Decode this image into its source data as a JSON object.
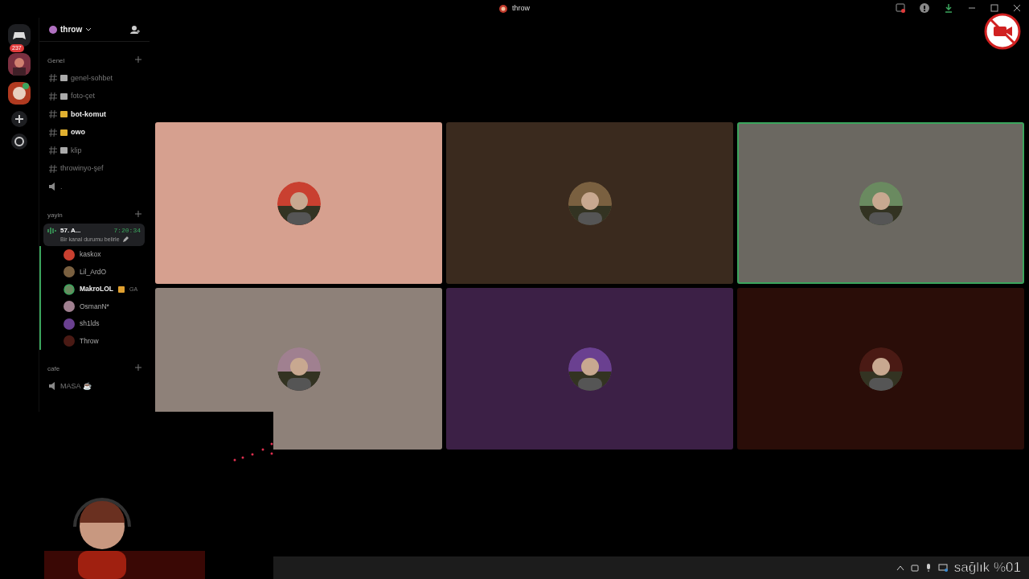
{
  "window": {
    "title": "throw"
  },
  "server_rail": {
    "badge": "237"
  },
  "server_header": {
    "name": "throw"
  },
  "categories": [
    {
      "name": "Genel",
      "channels": [
        {
          "name": "genel-sohbet",
          "kind": "text",
          "emoji": true,
          "unread": false
        },
        {
          "name": "foto-çet",
          "kind": "text",
          "emoji": true,
          "unread": false
        },
        {
          "name": "bot-komut",
          "kind": "text",
          "emoji": true,
          "unread": true
        },
        {
          "name": "owo",
          "kind": "text",
          "emoji": true,
          "unread": true
        },
        {
          "name": "klip",
          "kind": "text",
          "emoji": true,
          "unread": false
        },
        {
          "name": "throwinyo-şef",
          "kind": "text",
          "emoji": false,
          "unread": false
        },
        {
          "name": ".",
          "kind": "voice",
          "emoji": false,
          "unread": false
        }
      ]
    },
    {
      "name": "yayin",
      "voice_channel": {
        "name": "57. A...",
        "timer": "7:20:34",
        "status": "Bir kanal durumu belirle",
        "members": [
          {
            "name": "kaskox",
            "speaking": false
          },
          {
            "name": "Lil_ArdO",
            "speaking": false
          },
          {
            "name": "MakroLOL",
            "speaking": true,
            "tag": "GA"
          },
          {
            "name": "OsmanN*",
            "speaking": false
          },
          {
            "name": "sh1lds",
            "speaking": false
          },
          {
            "name": "Throw",
            "speaking": false
          }
        ]
      }
    },
    {
      "name": "cafe",
      "channels": [
        {
          "name": "MASA ☕",
          "kind": "voice",
          "emoji": false,
          "unread": false
        }
      ]
    }
  ],
  "tiles": [
    {
      "color": "#d6a08f",
      "speaking": false
    },
    {
      "color": "#3a2a1e",
      "speaking": false
    },
    {
      "color": "#6b6861",
      "speaking": true
    },
    {
      "color": "#8e8179",
      "speaking": false
    },
    {
      "color": "#3c2046",
      "speaking": false
    },
    {
      "color": "#2a0d08",
      "speaking": false
    }
  ],
  "overlay_text": "sağlık %01"
}
